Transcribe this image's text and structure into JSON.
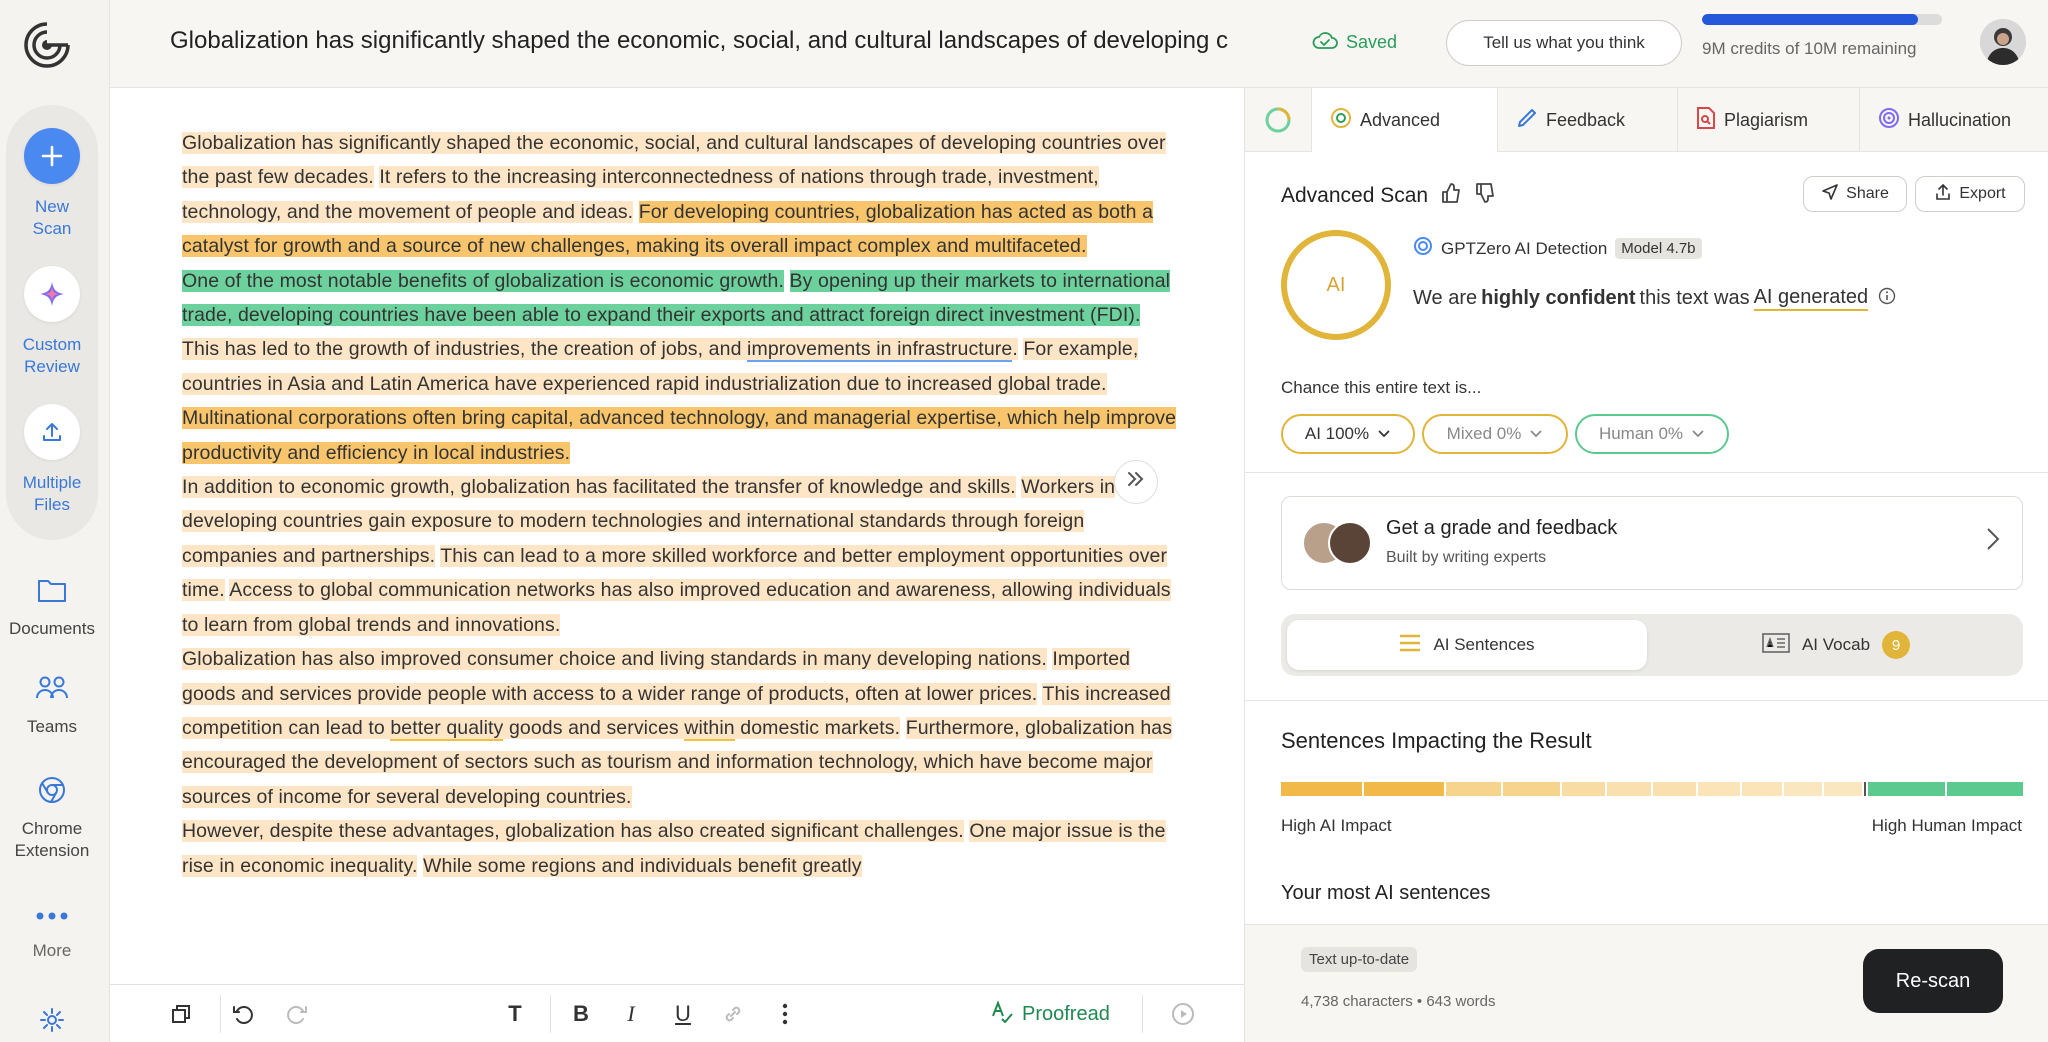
{
  "app": {
    "nav": {
      "new_scan": "New\nScan",
      "custom_review": "Custom\nReview",
      "multiple_files": "Multiple\nFiles",
      "documents": "Documents",
      "teams": "Teams",
      "chrome_extension": "Chrome\nExtension",
      "more": "More"
    }
  },
  "header": {
    "title": "Globalization has significantly shaped the economic, social, and cultural landscapes of developing c",
    "saved": "Saved",
    "feedback_btn": "Tell us what you think",
    "credits_text": "9M credits of 10M remaining",
    "credits_fraction": 0.9
  },
  "document": {
    "paragraphs": [
      [
        {
          "t": "Globalization has significantly shaped the economic, social, and cultural landscapes of developing countries over the past few decades.",
          "h": "l"
        },
        {
          "t": " ",
          "h": ""
        },
        {
          "t": "It refers to the increasing interconnectedness of nations through trade, investment, technology, and the movement of people and ideas.",
          "h": "l"
        },
        {
          "t": " ",
          "h": ""
        },
        {
          "t": "For developing countries, globalization has acted as both a catalyst for growth and a source of new challenges, making its overall impact complex and multifaceted.",
          "h": "d"
        }
      ],
      [
        {
          "t": "One of the most notable benefits of globalization is economic growth.",
          "h": "g"
        },
        {
          "t": " ",
          "h": ""
        },
        {
          "t": "By opening up their markets to international trade, developing countries have been able to expand their exports and attract foreign direct investment (FDI).",
          "h": "g"
        },
        {
          "t": " ",
          "h": ""
        },
        {
          "t": "This has led to the growth of industries, the creation of jobs, and ",
          "h": "l"
        },
        {
          "t": "improvements in infrastructure",
          "h": "l",
          "u": "blue"
        },
        {
          "t": ".",
          "h": "l"
        },
        {
          "t": " ",
          "h": ""
        },
        {
          "t": "For example, countries in Asia and Latin America have experienced rapid industrialization due to increased global trade.",
          "h": "l"
        },
        {
          "t": " ",
          "h": ""
        },
        {
          "t": "Multinational corporations often bring capital, advanced technology, and managerial expertise, which help improve productivity and efficiency in local industries.",
          "h": "d"
        }
      ],
      [
        {
          "t": "In addition to economic growth, globalization has facilitated the transfer of knowledge and skills.",
          "h": "l"
        },
        {
          "t": " ",
          "h": ""
        },
        {
          "t": "Workers in developing countries gain exposure to modern technologies and international standards through foreign companies and partnerships.",
          "h": "l"
        },
        {
          "t": " ",
          "h": ""
        },
        {
          "t": "This can lead to a more skilled workforce and better employment opportunities over time.",
          "h": "l"
        },
        {
          "t": " ",
          "h": ""
        },
        {
          "t": "Access to global communication networks has also improved education and awareness, allowing individuals to learn from global trends and innovations.",
          "h": "l"
        }
      ],
      [
        {
          "t": "Globalization has also improved consumer choice and living standards in many developing nations.",
          "h": "l"
        },
        {
          "t": " ",
          "h": ""
        },
        {
          "t": "Imported goods and services provide people with access to a wider range of products, often at lower prices.",
          "h": "l"
        },
        {
          "t": " ",
          "h": ""
        },
        {
          "t": "This increased competition can lead to ",
          "h": "l"
        },
        {
          "t": "better quality",
          "h": "l",
          "u": "yel"
        },
        {
          "t": " goods and services ",
          "h": "l"
        },
        {
          "t": "within",
          "h": "l",
          "u": "yel"
        },
        {
          "t": " domestic markets.",
          "h": "l"
        },
        {
          "t": " ",
          "h": ""
        },
        {
          "t": "Furthermore, globalization has encouraged the development of sectors such as tourism and information technology, which have become major sources of income for several developing countries.",
          "h": "l"
        }
      ],
      [
        {
          "t": "However, despite these advantages, globalization has also created significant challenges.",
          "h": "l"
        },
        {
          "t": " ",
          "h": ""
        },
        {
          "t": "One major issue is the rise in economic inequality.",
          "h": "l"
        },
        {
          "t": " ",
          "h": ""
        },
        {
          "t": "While some regions and individuals benefit greatly",
          "h": "l"
        }
      ]
    ]
  },
  "toolbar": {
    "proofread": "Proofread"
  },
  "panel": {
    "tabs": [
      "Advanced",
      "Feedback",
      "Plagiarism",
      "Hallucination"
    ],
    "scan_title": "Advanced Scan",
    "share": "Share",
    "export": "Export",
    "ai_badge": "AI",
    "detector": "GPTZero AI Detection",
    "model": "Model 4.7b",
    "verdict_pre": "We are",
    "verdict_bold": "highly confident",
    "verdict_mid": "this text was",
    "verdict_tag": "AI generated",
    "chance_label": "Chance this entire text is...",
    "pills": [
      "AI 100%",
      "Mixed 0%",
      "Human 0%"
    ],
    "grade_title": "Get a grade and feedback",
    "grade_sub": "Built by writing experts",
    "seg_sentences": "AI Sentences",
    "seg_vocab": "AI Vocab",
    "vocab_count": "9",
    "impact_title": "Sentences Impacting the Result",
    "impact_left": "High AI Impact",
    "impact_right": "High Human Impact",
    "most_ai": "Your most AI sentences",
    "up_to_date": "Text up-to-date",
    "char_count": "4,738 characters • 643 words",
    "rescan": "Re-scan"
  },
  "colors": {
    "accent": "#4a89f0",
    "ai_yellow": "#e1b43a",
    "human_green": "#5cc98f",
    "credits_blue": "#2457d9"
  }
}
